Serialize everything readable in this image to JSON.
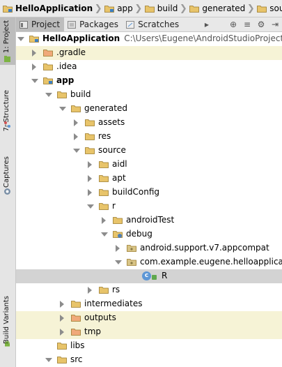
{
  "breadcrumb": [
    {
      "label": "HelloApplication",
      "icon": "project-folder-icon",
      "bold": true
    },
    {
      "label": "app",
      "icon": "module-folder-icon",
      "bold": false
    },
    {
      "label": "build",
      "icon": "folder-icon",
      "bold": false
    },
    {
      "label": "generated",
      "icon": "folder-icon",
      "bold": false
    },
    {
      "label": "source",
      "icon": "folder-icon",
      "bold": false
    }
  ],
  "left_strip": [
    {
      "label": "1: Project",
      "active": true,
      "icon": "project-tool-icon"
    },
    {
      "label": "7: Structure",
      "active": false,
      "icon": "structure-tool-icon"
    },
    {
      "label": "Captures",
      "active": false,
      "icon": "captures-tool-icon"
    },
    {
      "label": "Build Variants",
      "active": false,
      "icon": "android-icon"
    }
  ],
  "tabs": [
    {
      "label": "Project",
      "active": true,
      "icon": "project-view-icon"
    },
    {
      "label": "Packages",
      "active": false,
      "icon": "packages-icon"
    },
    {
      "label": "Scratches",
      "active": false,
      "icon": "scratches-icon"
    }
  ],
  "toolbar_icons": [
    "more-tabs-icon",
    "sync-icon",
    "collapse-all-icon",
    "settings-icon",
    "hide-icon"
  ],
  "tree": [
    {
      "label": "HelloApplication",
      "path": "C:\\Users\\Eugene\\AndroidStudioProjects\\HelloApplication",
      "expanded": true,
      "bold": true,
      "kind": "project"
    },
    {
      "label": ".gradle",
      "expanded": false,
      "kind": "folder-excluded",
      "hl": true
    },
    {
      "label": ".idea",
      "expanded": false,
      "kind": "folder"
    },
    {
      "label": "app",
      "expanded": true,
      "kind": "module",
      "bold": true
    },
    {
      "label": "build",
      "expanded": true,
      "kind": "folder"
    },
    {
      "label": "generated",
      "expanded": true,
      "kind": "folder"
    },
    {
      "label": "assets",
      "expanded": false,
      "kind": "folder"
    },
    {
      "label": "res",
      "expanded": false,
      "kind": "folder"
    },
    {
      "label": "source",
      "expanded": true,
      "kind": "folder"
    },
    {
      "label": "aidl",
      "expanded": false,
      "kind": "folder"
    },
    {
      "label": "apt",
      "expanded": false,
      "kind": "folder"
    },
    {
      "label": "buildConfig",
      "expanded": false,
      "kind": "folder"
    },
    {
      "label": "r",
      "expanded": true,
      "kind": "folder"
    },
    {
      "label": "androidTest",
      "expanded": false,
      "kind": "folder"
    },
    {
      "label": "debug",
      "expanded": true,
      "kind": "source-root"
    },
    {
      "label": "android.support.v7.appcompat",
      "expanded": false,
      "kind": "package"
    },
    {
      "label": "com.example.eugene.helloapplication",
      "expanded": true,
      "kind": "package"
    },
    {
      "label": "R",
      "kind": "class",
      "selected": true
    },
    {
      "label": "rs",
      "expanded": false,
      "kind": "folder"
    },
    {
      "label": "intermediates",
      "expanded": false,
      "kind": "folder"
    },
    {
      "label": "outputs",
      "expanded": false,
      "kind": "folder-excluded",
      "hl": true
    },
    {
      "label": "tmp",
      "expanded": false,
      "kind": "folder-excluded",
      "hl": true
    },
    {
      "label": "libs",
      "kind": "folder",
      "leaf": true
    },
    {
      "label": "src",
      "expanded": true,
      "kind": "folder"
    }
  ],
  "colors": {
    "folder": "#e8c46a",
    "folder_excluded": "#f0a97a",
    "package": "#d8c486",
    "class_circle": "#5d97d6",
    "highlight_row": "#f6f3d6",
    "selected_row": "#d3d3d3"
  }
}
